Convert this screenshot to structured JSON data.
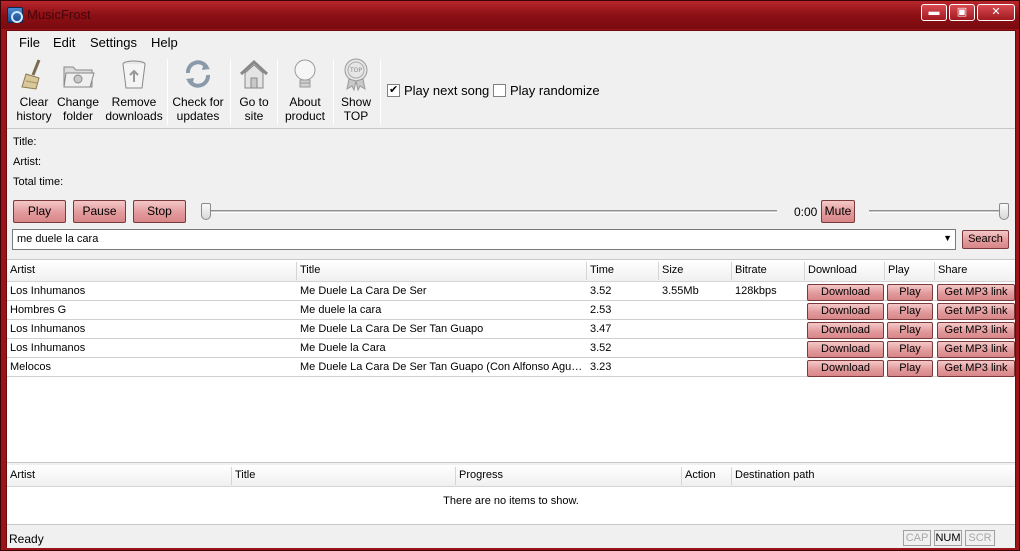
{
  "window": {
    "title": "MusicFrost",
    "min_label": "▬",
    "max_label": "▣",
    "close_label": "✕"
  },
  "menu": [
    "File",
    "Edit",
    "Settings",
    "Help"
  ],
  "toolbar": {
    "buttons": [
      {
        "line1": "Clear",
        "line2": "history",
        "icon": "broom-icon"
      },
      {
        "line1": "Change",
        "line2": "folder",
        "icon": "folder-icon"
      },
      {
        "line1": "Remove",
        "line2": "downloads",
        "icon": "trash-icon"
      },
      {
        "line1": "Check for",
        "line2": "updates",
        "icon": "refresh-icon"
      },
      {
        "line1": "Go to",
        "line2": "site",
        "icon": "home-icon"
      },
      {
        "line1": "About",
        "line2": "product",
        "icon": "lightbulb-icon"
      },
      {
        "line1": "Show",
        "line2": "TOP",
        "icon": "top-badge-icon"
      }
    ],
    "play_next_song": {
      "label": "Play next song",
      "checked": true
    },
    "play_randomize": {
      "label": "Play randomize",
      "checked": false
    }
  },
  "info": {
    "title_label": "Title:",
    "artist_label": "Artist:",
    "total_time_label": "Total time:"
  },
  "player": {
    "play": "Play",
    "pause": "Pause",
    "stop": "Stop",
    "time": "0:00",
    "mute": "Mute",
    "progress_fraction": 0.0,
    "volume_fraction": 1.0
  },
  "search": {
    "query": "me duele la cara",
    "button": "Search"
  },
  "results": {
    "columns": [
      "Artist",
      "Title",
      "Time",
      "Size",
      "Bitrate",
      "Download",
      "Play",
      "Share"
    ],
    "rows": [
      {
        "artist": "Los Inhumanos",
        "title": "Me Duele La Cara De Ser",
        "time": "3.52",
        "size": "3.55Mb",
        "bitrate": "128kbps"
      },
      {
        "artist": "Hombres G",
        "title": "Me duele la cara",
        "time": "2.53",
        "size": "",
        "bitrate": ""
      },
      {
        "artist": "Los Inhumanos",
        "title": "Me Duele La Cara De Ser Tan Guapo",
        "time": "3.47",
        "size": "",
        "bitrate": ""
      },
      {
        "artist": "Los Inhumanos",
        "title": " Me Duele la Cara",
        "time": "3.52",
        "size": "",
        "bitrate": ""
      },
      {
        "artist": "Melocos",
        "title": "Me Duele La Cara De Ser Tan Guapo (Con Alfonso Aguado)",
        "time": "3.23",
        "size": "",
        "bitrate": ""
      }
    ],
    "download_label": "Download",
    "play_label": "Play",
    "share_label": "Get MP3 link"
  },
  "downloads": {
    "columns": [
      "Artist",
      "Title",
      "Progress",
      "Action",
      "Destination path"
    ],
    "empty_text": "There are no items to show."
  },
  "status": {
    "text": "Ready",
    "caps": "CAP",
    "num": "NUM",
    "scroll": "SCR"
  }
}
